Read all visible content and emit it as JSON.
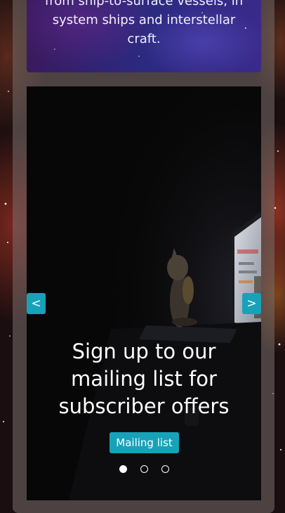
{
  "info_card": {
    "text": "from ship-to-surface vessels, in system ships and interstellar craft."
  },
  "carousel": {
    "caption": "Sign up to our mailing list for subscriber offers",
    "cta_label": "Mailing list",
    "prev_label": "<",
    "next_label": ">",
    "slide_count": 3,
    "active_slide": 1,
    "colors": {
      "accent": "#17a2b8",
      "dot": "#ffffff"
    }
  }
}
